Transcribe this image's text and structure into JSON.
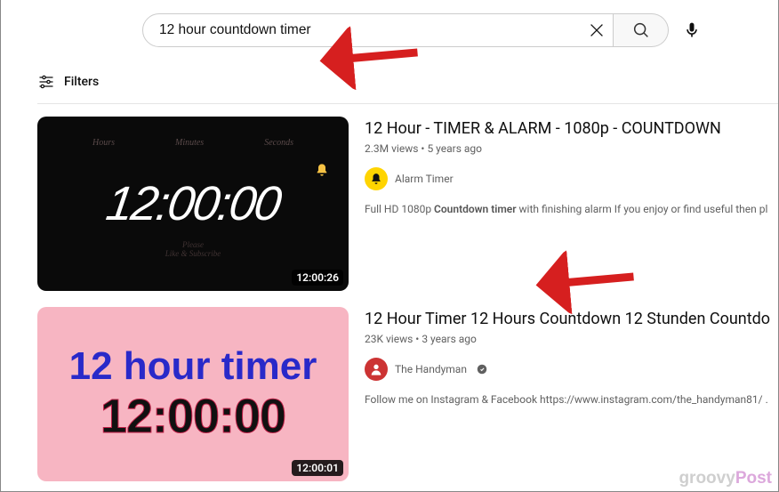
{
  "search": {
    "query": "12 hour countdown timer"
  },
  "filters": {
    "label": "Filters"
  },
  "results": [
    {
      "title": "12 Hour - TIMER & ALARM - 1080p - COUNTDOWN",
      "views": "2.3M views",
      "age": "5 years ago",
      "channel": "Alarm Timer",
      "verified": false,
      "desc_pre": "Full HD 1080p ",
      "desc_bold": "Countdown timer",
      "desc_post": " with finishing alarm If you enjoy or find useful then pl",
      "duration": "12:00:26",
      "thumb": {
        "labels": [
          "Hours",
          "Minutes",
          "Seconds"
        ],
        "digits": "12:00:00",
        "sub1": "Please",
        "sub2": "Like & Subscribe"
      }
    },
    {
      "title": "12 Hour Timer 12 Hours Countdown 12 Stunden Countdo",
      "views": "23K views",
      "age": "3 years ago",
      "channel": "The Handyman",
      "verified": true,
      "desc_full": "Follow me on Instagram & Facebook https://www.instagram.com/the_handyman81/ .",
      "duration": "12:00:01",
      "thumb": {
        "headline": "12 hour timer",
        "digits": "12:00:00"
      }
    }
  ],
  "watermark": {
    "left": "groovy",
    "right": "Post"
  }
}
